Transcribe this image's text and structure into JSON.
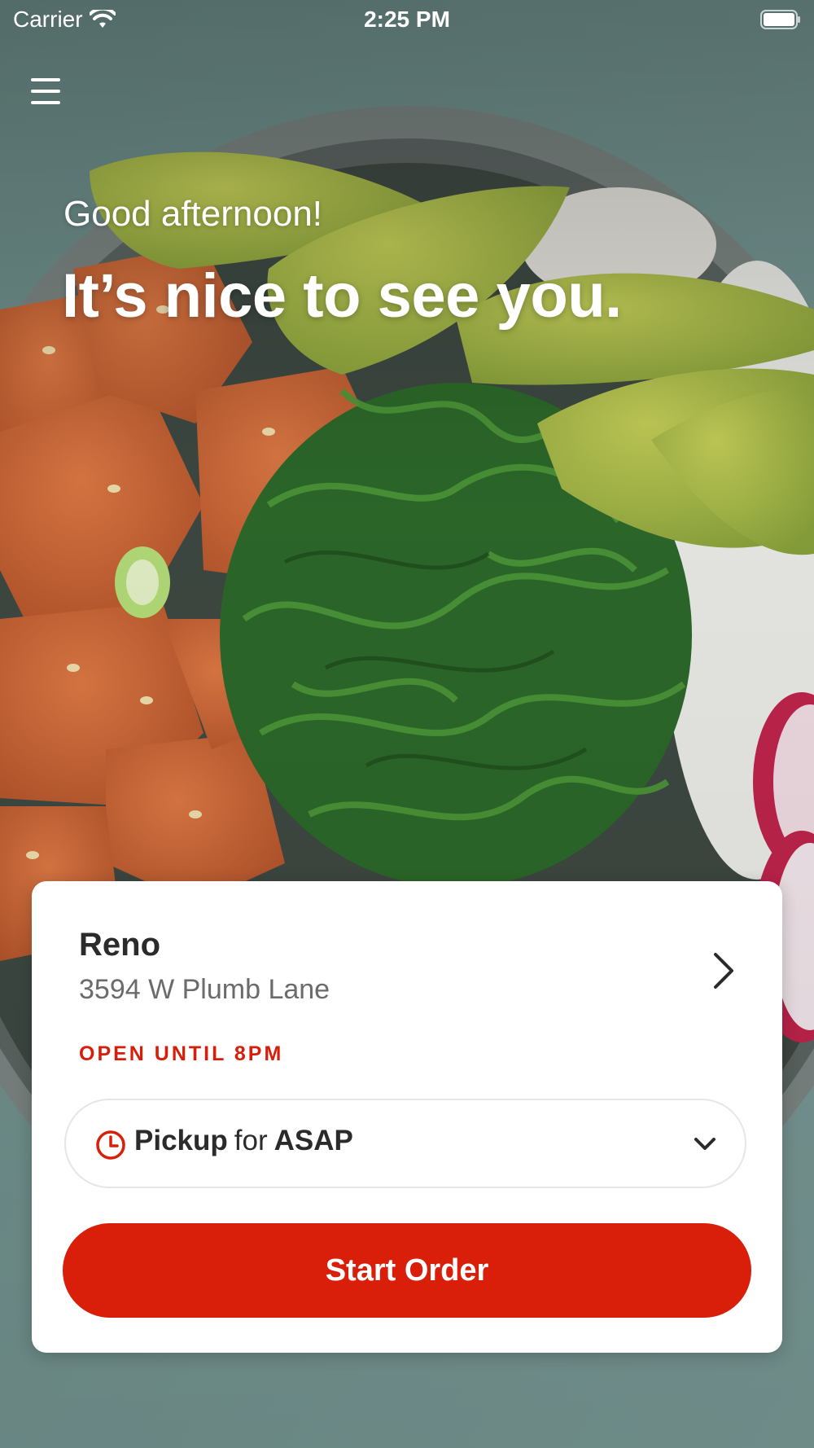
{
  "status_bar": {
    "carrier": "Carrier",
    "time": "2:25 PM"
  },
  "greeting": {
    "subtitle": "Good afternoon!",
    "title": "It’s nice to see you."
  },
  "location": {
    "name": "Reno",
    "address": "3594 W Plumb Lane",
    "hours": "OPEN UNTIL 8PM"
  },
  "order_mode": {
    "mode": "Pickup",
    "connector": "for",
    "time": "ASAP"
  },
  "actions": {
    "start_order": "Start Order"
  },
  "colors": {
    "accent": "#d91e0a",
    "hours_text": "#d61e0a",
    "card_background": "#ffffff"
  },
  "icons": [
    "hamburger-menu-icon",
    "wifi-icon",
    "battery-icon",
    "chevron-right-icon",
    "clock-icon",
    "chevron-down-icon"
  ]
}
